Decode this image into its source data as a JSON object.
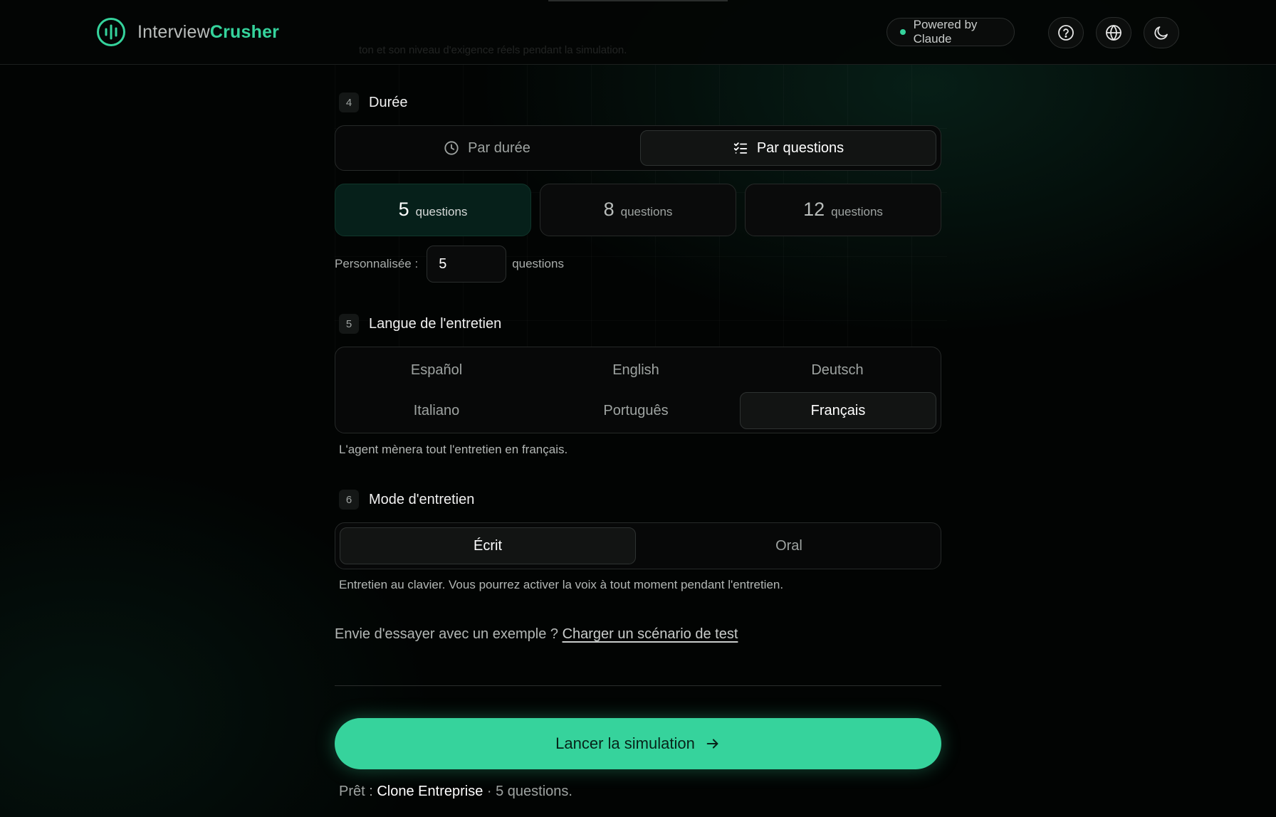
{
  "header": {
    "logo_part1": "Interview",
    "logo_part2": "Crusher",
    "ghost_text": "ton et son niveau d'exigence réels pendant la simulation.",
    "powered_by": "Powered by Claude",
    "icons": [
      "help-icon",
      "globe-icon",
      "moon-icon"
    ]
  },
  "duration": {
    "step": "4",
    "title": "Durée",
    "modes": [
      {
        "label": "Par durée",
        "icon": "clock-icon",
        "active": false
      },
      {
        "label": "Par questions",
        "icon": "checklist-icon",
        "active": true
      }
    ],
    "presets": [
      {
        "value": "5",
        "unit": "questions",
        "active": true
      },
      {
        "value": "8",
        "unit": "questions",
        "active": false
      },
      {
        "value": "12",
        "unit": "questions",
        "active": false
      }
    ],
    "custom_label": "Personnalisée :",
    "custom_value": "5",
    "custom_unit": "questions"
  },
  "language": {
    "step": "5",
    "title": "Langue de l'entretien",
    "options": [
      {
        "label": "Español",
        "active": false
      },
      {
        "label": "English",
        "active": false
      },
      {
        "label": "Deutsch",
        "active": false
      },
      {
        "label": "Italiano",
        "active": false
      },
      {
        "label": "Português",
        "active": false
      },
      {
        "label": "Français",
        "active": true
      }
    ],
    "note": "L'agent mènera tout l'entretien en français."
  },
  "mode": {
    "step": "6",
    "title": "Mode d'entretien",
    "options": [
      {
        "label": "Écrit",
        "active": true
      },
      {
        "label": "Oral",
        "active": false
      }
    ],
    "note": "Entretien au clavier. Vous pourrez activer la voix à tout moment pendant l'entretien."
  },
  "example": {
    "prompt": "Envie d'essayer avec un exemple ?",
    "link": "Charger un scénario de test"
  },
  "launch": {
    "label": "Lancer la simulation"
  },
  "ready": {
    "prefix": "Prêt :",
    "company": "Clone Entreprise",
    "suffix": "· 5 questions."
  },
  "colors": {
    "accent": "#35d39c",
    "background": "#020403"
  }
}
